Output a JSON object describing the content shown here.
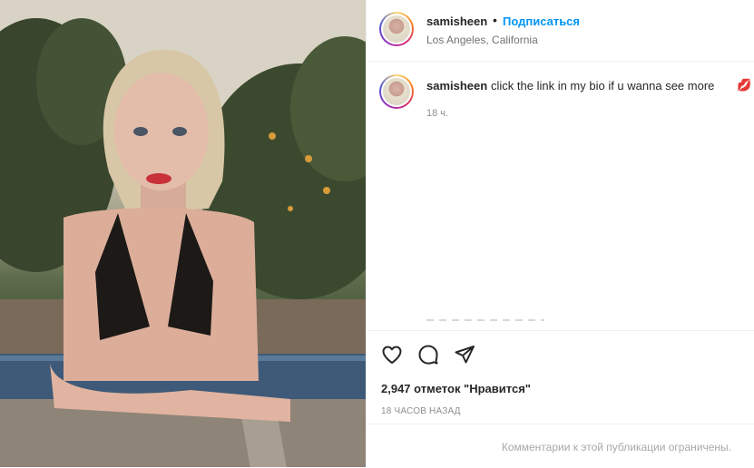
{
  "post": {
    "author": {
      "username": "samisheen",
      "separator": "•",
      "follow_label": "Подписаться",
      "location": "Los Angeles, California"
    },
    "caption": {
      "username": "samisheen",
      "text": "click the link in my bio if u wanna see more",
      "emoji": "💋",
      "time": "18 ч."
    },
    "actions": {
      "like_icon": "heart-icon",
      "comment_icon": "comment-icon",
      "share_icon": "paper-plane-icon"
    },
    "likes": "2,947 отметок \"Нравится\"",
    "date": "18 ЧАСОВ НАЗАД",
    "comments_disabled": "Комментарии к этой публикации ограничены."
  }
}
